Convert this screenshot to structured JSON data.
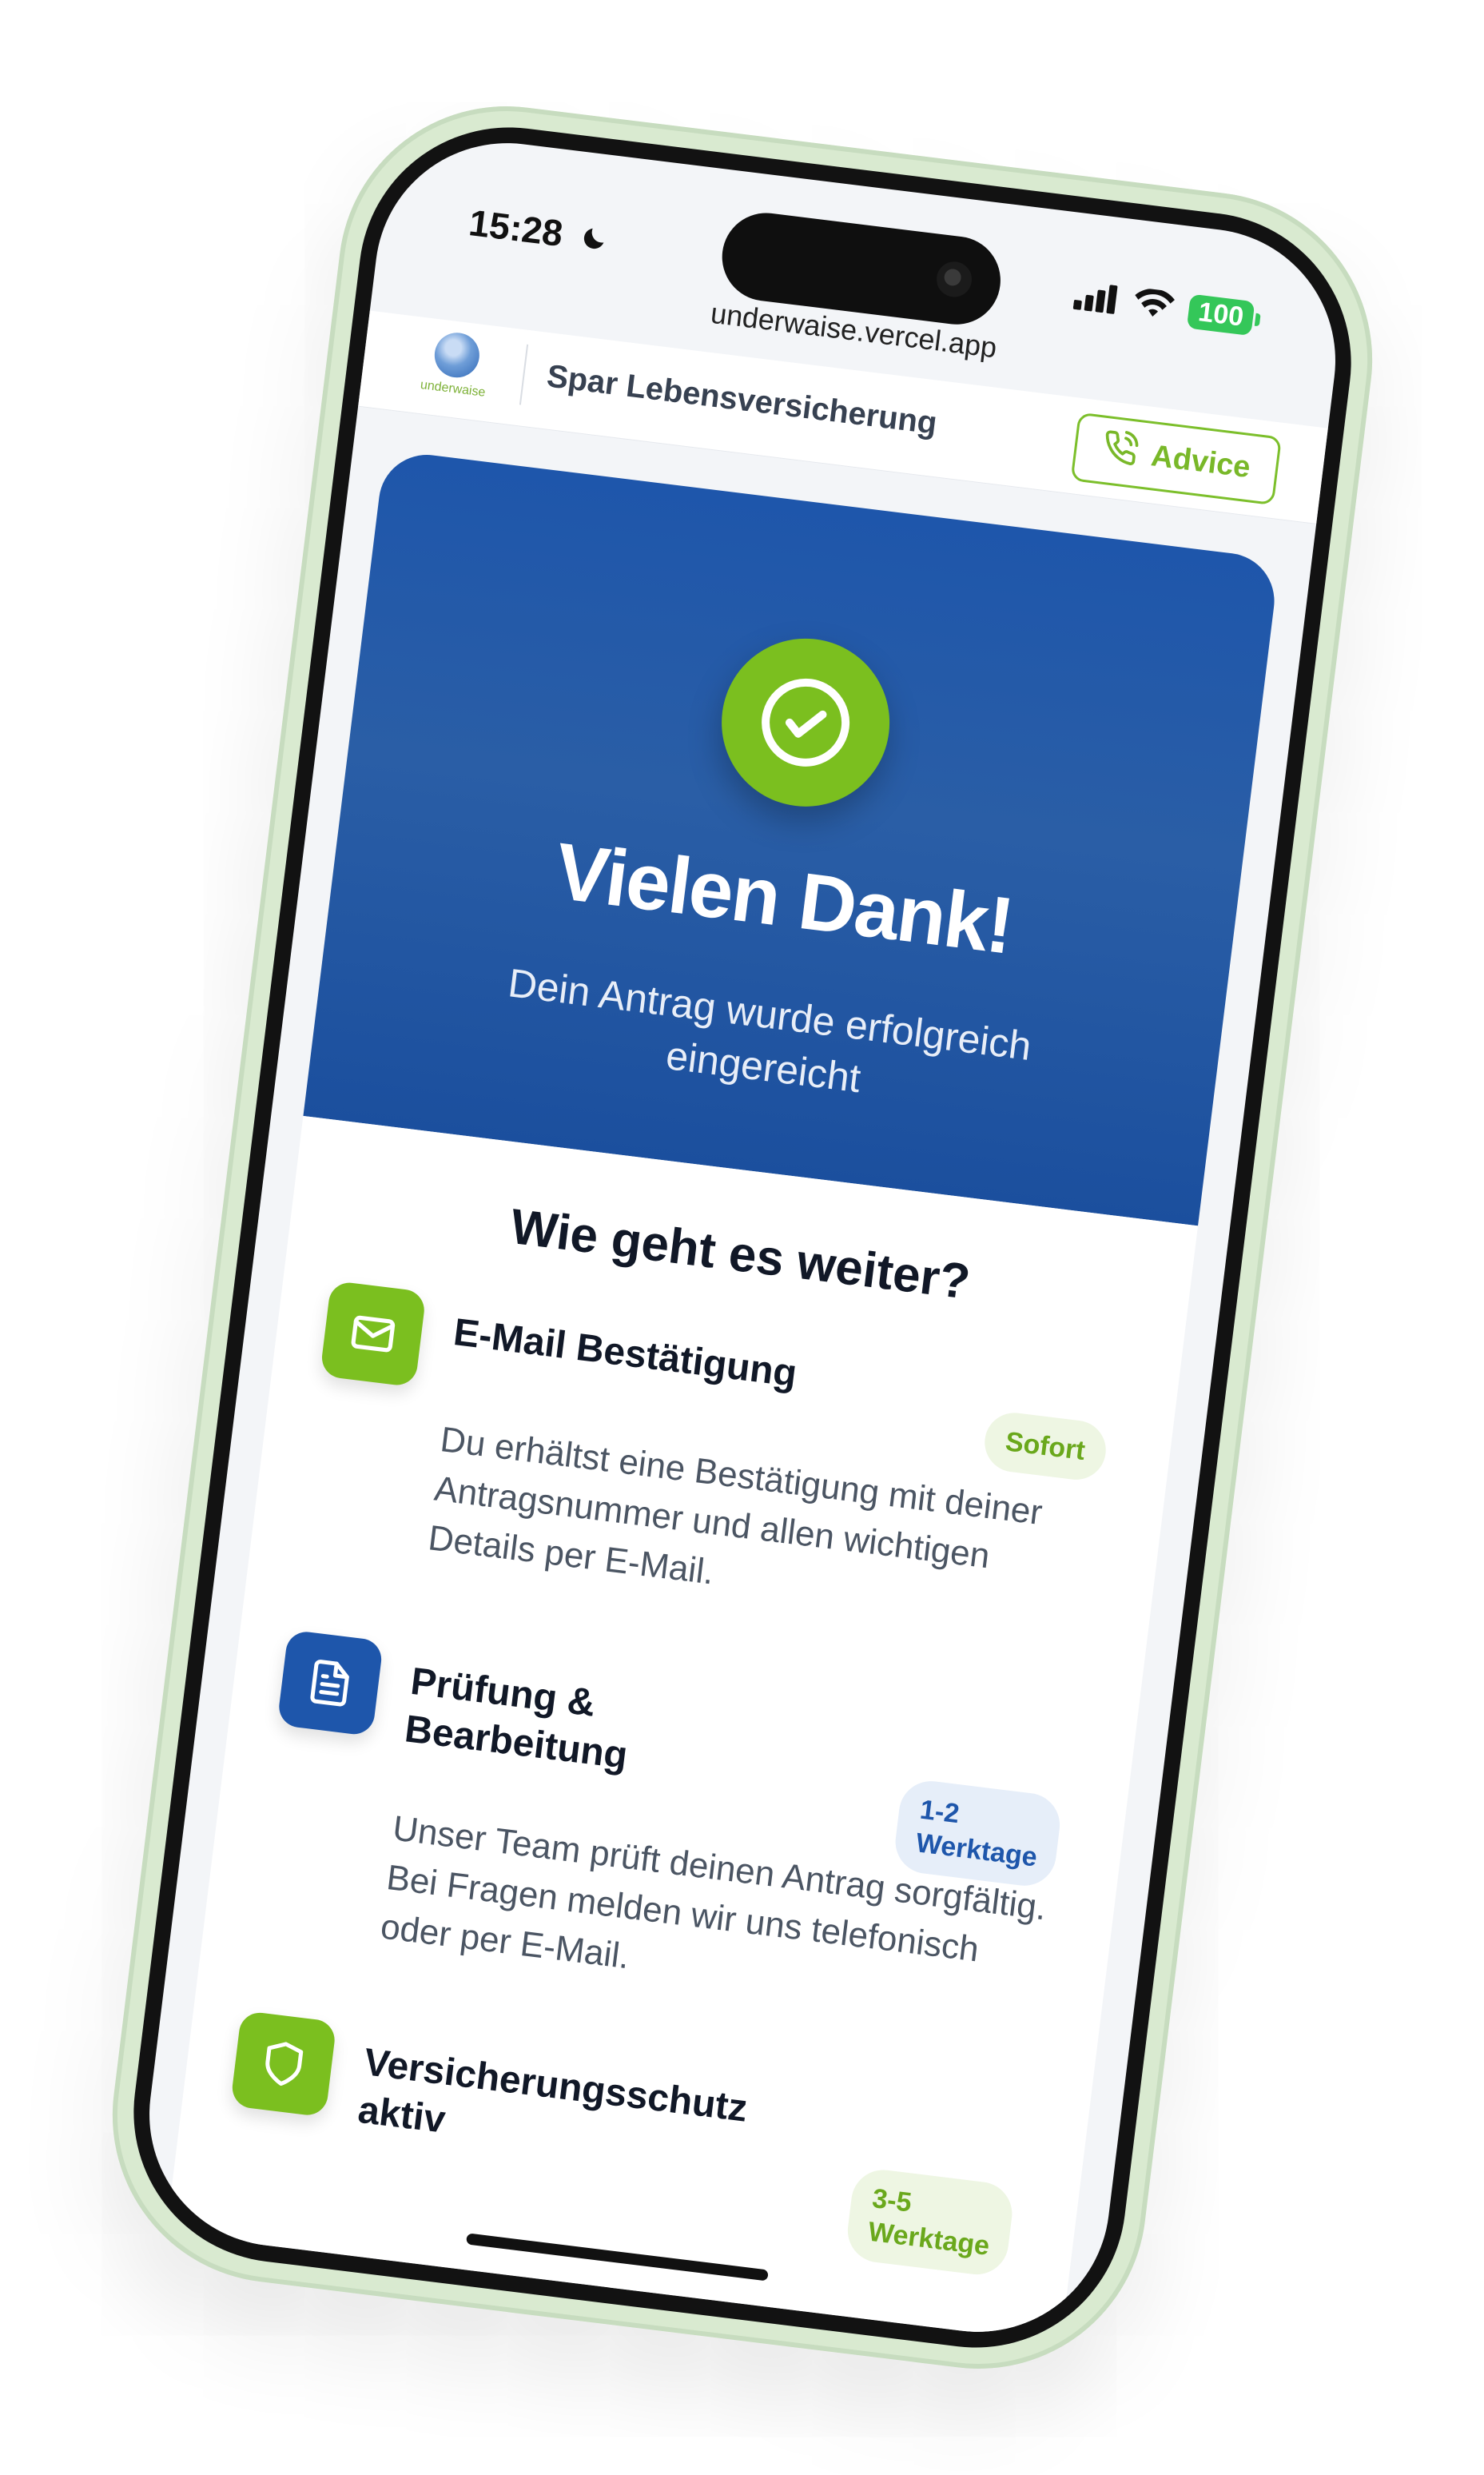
{
  "status_bar": {
    "time": "15:28",
    "battery": "100"
  },
  "browser": {
    "url": "underwaise.vercel.app"
  },
  "header": {
    "logo_text": "underwaise",
    "title": "Spar Lebensversicherung",
    "advice_label": "Advice"
  },
  "hero": {
    "title": "Vielen Dank!",
    "subtitle": "Dein Antrag wurde erfolgreich eingereicht"
  },
  "next_steps": {
    "title": "Wie geht es weiter?",
    "steps": [
      {
        "title": "E-Mail Bestätigung",
        "badge": "Sofort",
        "description": "Du erhältst eine Bestätigung mit deiner Antragsnummer und allen wichtigen Details per E-Mail.",
        "icon": "mail-icon"
      },
      {
        "title": "Prüfung & Bearbeitung",
        "badge": "1-2 Werktage",
        "description": "Unser Team prüft deinen Antrag sorgfältig. Bei Fragen melden wir uns telefonisch oder per E-Mail.",
        "icon": "document-icon"
      },
      {
        "title": "Versicherungsschutz aktiv",
        "badge": "3-5 Werktage",
        "description": "",
        "icon": "shield-icon"
      }
    ]
  },
  "colors": {
    "brand_green": "#7bbf1f",
    "brand_blue": "#1e56ab",
    "text_dark": "#111827"
  }
}
